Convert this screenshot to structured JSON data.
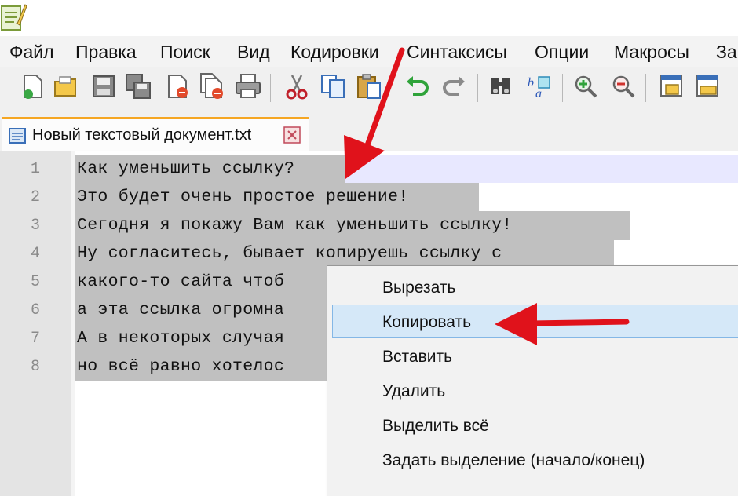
{
  "menubar": {
    "items": [
      "Файл",
      "Правка",
      "Поиск",
      "Вид",
      "Кодировки",
      "Синтаксисы",
      "Опции",
      "Макросы",
      "За"
    ]
  },
  "toolbar": {
    "buttons": [
      "new-file-icon",
      "open-file-icon",
      "save-icon",
      "save-all-icon",
      "close-icon",
      "close-all-icon",
      "print-icon",
      "cut-icon",
      "copy-icon",
      "paste-icon",
      "undo-icon",
      "redo-icon",
      "find-icon",
      "replace-icon",
      "zoom-in-icon",
      "zoom-out-icon",
      "sync-vertical-icon",
      "sync-horizontal-icon"
    ]
  },
  "tab": {
    "label": "Новый текстовый документ.txt"
  },
  "editor": {
    "line_numbers": [
      "1",
      "2",
      "3",
      "4",
      "5",
      "6",
      "7",
      "8"
    ],
    "lines": [
      "Как уменьшить ссылку?",
      "Это будет очень простое решение!",
      "Сегодня я покажу Вам как уменьшить ссылку!",
      "Ну согласитесь, бывает копируешь ссылку с",
      "какого-то сайта чтоб",
      "а эта ссылка огромна",
      "А в некоторых случая",
      "но всё равно хотелос"
    ]
  },
  "context_menu": {
    "items": [
      "Вырезать",
      "Копировать",
      "Вставить",
      "Удалить",
      "Выделить всё",
      "Задать выделение (начало/конец)"
    ],
    "highlighted": "Копировать"
  },
  "colors": {
    "arrow": "#e0121b",
    "selection": "#c0c0c0",
    "current_line": "#e8e8ff",
    "tab_accent": "#f5a623",
    "menu_highlight": "#d5e8f8"
  }
}
